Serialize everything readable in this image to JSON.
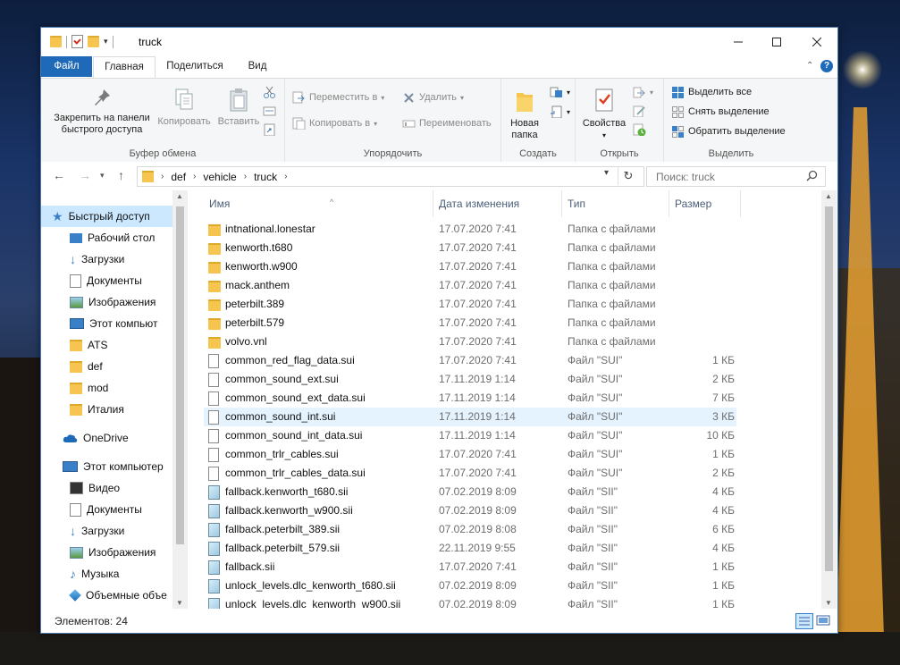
{
  "window": {
    "title": "truck"
  },
  "tabs": {
    "file": "Файл",
    "home": "Главная",
    "share": "Поделиться",
    "view": "Вид"
  },
  "ribbon": {
    "clipboard": {
      "pin": "Закрепить на панели быстрого доступа",
      "pin_l1": "Закрепить на панели",
      "pin_l2": "быстрого доступа",
      "copy": "Копировать",
      "paste": "Вставить",
      "label": "Буфер обмена"
    },
    "organize": {
      "move_to": "Переместить в",
      "copy_to": "Копировать в",
      "delete": "Удалить",
      "rename": "Переименовать",
      "label": "Упорядочить"
    },
    "create": {
      "new_folder_l1": "Новая",
      "new_folder_l2": "папка",
      "label": "Создать"
    },
    "open": {
      "properties": "Свойства",
      "label": "Открыть"
    },
    "select": {
      "select_all": "Выделить все",
      "select_none": "Снять выделение",
      "invert": "Обратить выделение",
      "label": "Выделить"
    }
  },
  "address": {
    "path": [
      "def",
      "vehicle",
      "truck"
    ]
  },
  "search": {
    "placeholder": "Поиск: truck"
  },
  "nav": {
    "quick_access": "Быстрый доступ",
    "items": [
      "Рабочий стол",
      "Загрузки",
      "Документы",
      "Изображения",
      "Этот компьют",
      "ATS",
      "def",
      "mod",
      "Италия"
    ],
    "onedrive": "OneDrive",
    "this_pc": "Этот компьютер",
    "pc_items": [
      "Видео",
      "Документы",
      "Загрузки",
      "Изображения",
      "Музыка",
      "Объемные объе"
    ]
  },
  "columns": {
    "name": "Имя",
    "date": "Дата изменения",
    "type": "Тип",
    "size": "Размер"
  },
  "files": [
    {
      "name": "intnational.lonestar",
      "date": "17.07.2020 7:41",
      "type": "Папка с файлами",
      "size": "",
      "kind": "folder"
    },
    {
      "name": "kenworth.t680",
      "date": "17.07.2020 7:41",
      "type": "Папка с файлами",
      "size": "",
      "kind": "folder"
    },
    {
      "name": "kenworth.w900",
      "date": "17.07.2020 7:41",
      "type": "Папка с файлами",
      "size": "",
      "kind": "folder"
    },
    {
      "name": "mack.anthem",
      "date": "17.07.2020 7:41",
      "type": "Папка с файлами",
      "size": "",
      "kind": "folder"
    },
    {
      "name": "peterbilt.389",
      "date": "17.07.2020 7:41",
      "type": "Папка с файлами",
      "size": "",
      "kind": "folder"
    },
    {
      "name": "peterbilt.579",
      "date": "17.07.2020 7:41",
      "type": "Папка с файлами",
      "size": "",
      "kind": "folder"
    },
    {
      "name": "volvo.vnl",
      "date": "17.07.2020 7:41",
      "type": "Папка с файлами",
      "size": "",
      "kind": "folder"
    },
    {
      "name": "common_red_flag_data.sui",
      "date": "17.07.2020 7:41",
      "type": "Файл \"SUI\"",
      "size": "1 КБ",
      "kind": "doc"
    },
    {
      "name": "common_sound_ext.sui",
      "date": "17.11.2019 1:14",
      "type": "Файл \"SUI\"",
      "size": "2 КБ",
      "kind": "doc"
    },
    {
      "name": "common_sound_ext_data.sui",
      "date": "17.11.2019 1:14",
      "type": "Файл \"SUI\"",
      "size": "7 КБ",
      "kind": "doc"
    },
    {
      "name": "common_sound_int.sui",
      "date": "17.11.2019 1:14",
      "type": "Файл \"SUI\"",
      "size": "3 КБ",
      "kind": "doc"
    },
    {
      "name": "common_sound_int_data.sui",
      "date": "17.11.2019 1:14",
      "type": "Файл \"SUI\"",
      "size": "10 КБ",
      "kind": "doc"
    },
    {
      "name": "common_trlr_cables.sui",
      "date": "17.07.2020 7:41",
      "type": "Файл \"SUI\"",
      "size": "1 КБ",
      "kind": "doc"
    },
    {
      "name": "common_trlr_cables_data.sui",
      "date": "17.07.2020 7:41",
      "type": "Файл \"SUI\"",
      "size": "2 КБ",
      "kind": "doc"
    },
    {
      "name": "fallback.kenworth_t680.sii",
      "date": "07.02.2019 8:09",
      "type": "Файл \"SII\"",
      "size": "4 КБ",
      "kind": "sii"
    },
    {
      "name": "fallback.kenworth_w900.sii",
      "date": "07.02.2019 8:09",
      "type": "Файл \"SII\"",
      "size": "4 КБ",
      "kind": "sii"
    },
    {
      "name": "fallback.peterbilt_389.sii",
      "date": "07.02.2019 8:08",
      "type": "Файл \"SII\"",
      "size": "6 КБ",
      "kind": "sii"
    },
    {
      "name": "fallback.peterbilt_579.sii",
      "date": "22.11.2019 9:55",
      "type": "Файл \"SII\"",
      "size": "4 КБ",
      "kind": "sii"
    },
    {
      "name": "fallback.sii",
      "date": "17.07.2020 7:41",
      "type": "Файл \"SII\"",
      "size": "1 КБ",
      "kind": "sii"
    },
    {
      "name": "unlock_levels.dlc_kenworth_t680.sii",
      "date": "07.02.2019 8:09",
      "type": "Файл \"SII\"",
      "size": "1 КБ",
      "kind": "sii"
    },
    {
      "name": "unlock_levels.dlc_kenworth_w900.sii",
      "date": "07.02.2019 8:09",
      "type": "Файл \"SII\"",
      "size": "1 КБ",
      "kind": "sii"
    }
  ],
  "status": {
    "count": "Элементов: 24"
  },
  "colors": {
    "accent": "#1e6ab8",
    "selection": "#cce8ff",
    "hover": "#e5f3ff",
    "folder": "#f5c550"
  }
}
